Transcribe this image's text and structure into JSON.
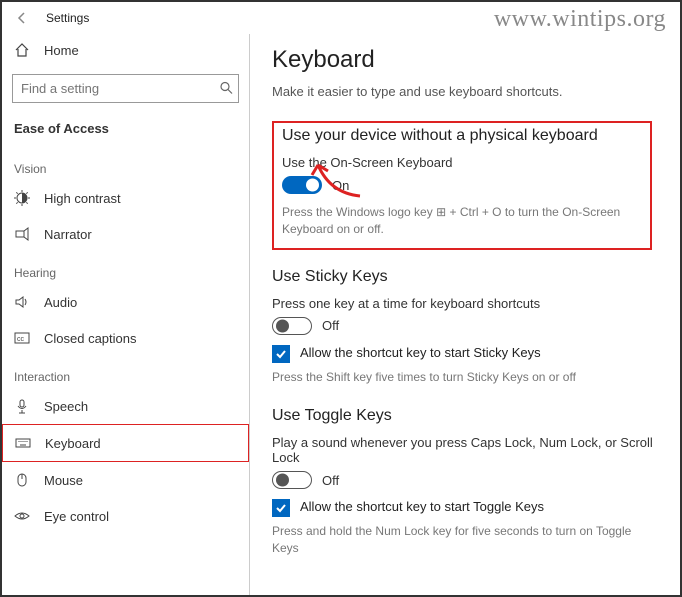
{
  "watermark": "www.wintips.org",
  "titlebar": {
    "label": "Settings"
  },
  "sidebar": {
    "home": "Home",
    "search_placeholder": "Find a setting",
    "category": "Ease of Access",
    "groups": {
      "vision": "Vision",
      "hearing": "Hearing",
      "interaction": "Interaction"
    },
    "items": {
      "high_contrast": "High contrast",
      "narrator": "Narrator",
      "audio": "Audio",
      "closed_captions": "Closed captions",
      "speech": "Speech",
      "keyboard": "Keyboard",
      "mouse": "Mouse",
      "eye_control": "Eye control"
    }
  },
  "main": {
    "title": "Keyboard",
    "subtitle": "Make it easier to type and use keyboard shortcuts.",
    "osk": {
      "heading": "Use your device without a physical keyboard",
      "label": "Use the On-Screen Keyboard",
      "state": "On",
      "hint_before": "Press the Windows logo key ",
      "hint_after": " + Ctrl + O to turn the On-Screen Keyboard on or off."
    },
    "sticky": {
      "heading": "Use Sticky Keys",
      "label": "Press one key at a time for keyboard shortcuts",
      "state": "Off",
      "chk_label": "Allow the shortcut key to start Sticky Keys",
      "hint": "Press the Shift key five times to turn Sticky Keys on or off"
    },
    "toggle_keys": {
      "heading": "Use Toggle Keys",
      "label": "Play a sound whenever you press Caps Lock, Num Lock, or Scroll Lock",
      "state": "Off",
      "chk_label": "Allow the shortcut key to start Toggle Keys",
      "hint": "Press and hold the Num Lock key for five seconds to turn on Toggle Keys"
    }
  }
}
